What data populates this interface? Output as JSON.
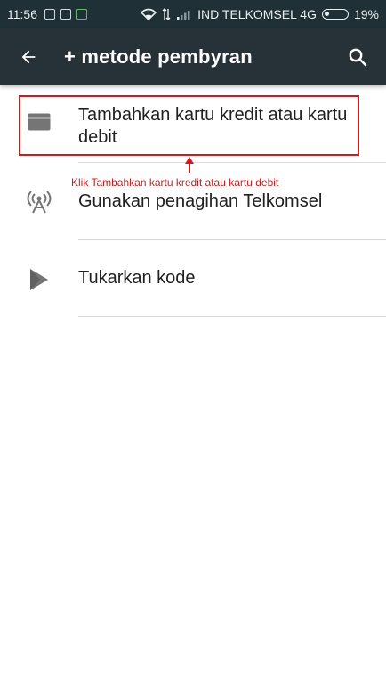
{
  "status_bar": {
    "time": "11:56",
    "carrier": "IND TELKOMSEL 4G",
    "battery": "19%",
    "network_type": "4G"
  },
  "app_bar": {
    "back_icon": "arrow-left-icon",
    "title": "+ metode pembyran",
    "search_icon": "search-icon"
  },
  "payment_options": [
    {
      "label": "Tambahkan kartu kredit atau kartu debit",
      "icon": "credit-card-icon"
    },
    {
      "label": "Gunakan penagihan Telkomsel",
      "icon": "cell-tower-icon"
    },
    {
      "label": "Tukarkan kode",
      "icon": "play-store-icon"
    }
  ],
  "annotation": {
    "note": "Klik Tambahkan kartu kredit atau kartu debit",
    "color": "#d11a1a"
  },
  "colors": {
    "status_bar_bg": "#1f3036",
    "app_bar_bg": "#263238",
    "text_primary": "#212121",
    "icon_gray": "#757575",
    "divider": "#dcdcdc"
  }
}
